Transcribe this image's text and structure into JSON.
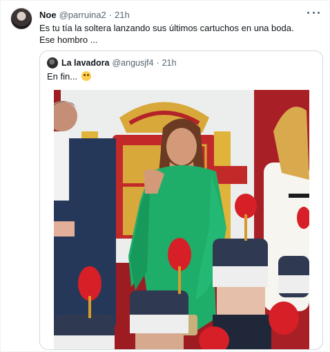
{
  "tweet": {
    "author_name": "Noe",
    "author_handle": "@parruina2",
    "separator": "·",
    "time": "21h",
    "text_lines": [
      "Es tu tía la soltera lanzando sus últimos cartuchos en una boda.",
      "Ese hombro ..."
    ],
    "more_icon": "more-horizontal-icon"
  },
  "quoted_tweet": {
    "author_name": "La lavadora",
    "author_handle": "@angusjf4",
    "separator": "·",
    "time": "21h",
    "text": "En fin...",
    "emoji_icon": "flushed-face-emoji",
    "photo_icon": "ceremony-photo"
  },
  "colors": {
    "text_primary": "#0f1419",
    "text_secondary": "#536471",
    "border": "#cfd9de",
    "dress_green": "#1fae6a",
    "backdrop_red": "#b01e25",
    "crest_gold": "#e0b43a"
  }
}
